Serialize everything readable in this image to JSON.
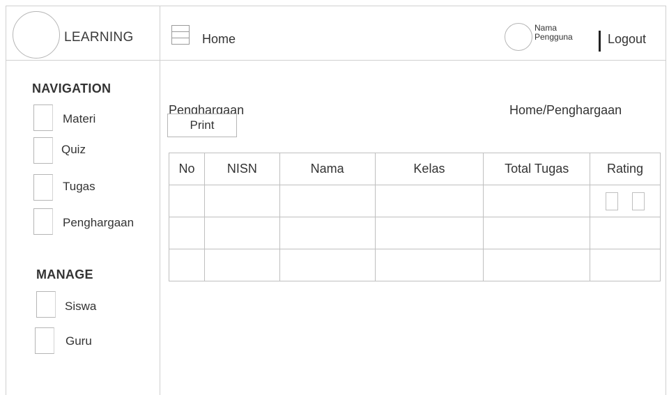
{
  "brand": {
    "title": "LEARNING"
  },
  "topbar": {
    "home_label": "Home",
    "user_name_line1": "Nama",
    "user_name_line2": "Pengguna",
    "logout_label": "Logout"
  },
  "sidebar": {
    "navigation_title": "NAVIGATION",
    "navigation_items": [
      {
        "label": "Materi"
      },
      {
        "label": "Quiz"
      },
      {
        "label": "Tugas"
      },
      {
        "label": "Penghargaan"
      }
    ],
    "manage_title": "MANAGE",
    "manage_items": [
      {
        "label": "Siswa"
      },
      {
        "label": "Guru"
      }
    ]
  },
  "main": {
    "page_title": "Penghargaan",
    "breadcrumb": "Home/Penghargaan",
    "print_label": "Print",
    "table": {
      "headers": [
        "No",
        "NISN",
        "Nama",
        "Kelas",
        "Total Tugas",
        "Rating"
      ],
      "rows": [
        [
          "",
          "",
          "",
          "",
          "",
          ""
        ],
        [
          "",
          "",
          "",
          "",
          "",
          ""
        ],
        [
          "",
          "",
          "",
          "",
          "",
          ""
        ]
      ]
    }
  }
}
